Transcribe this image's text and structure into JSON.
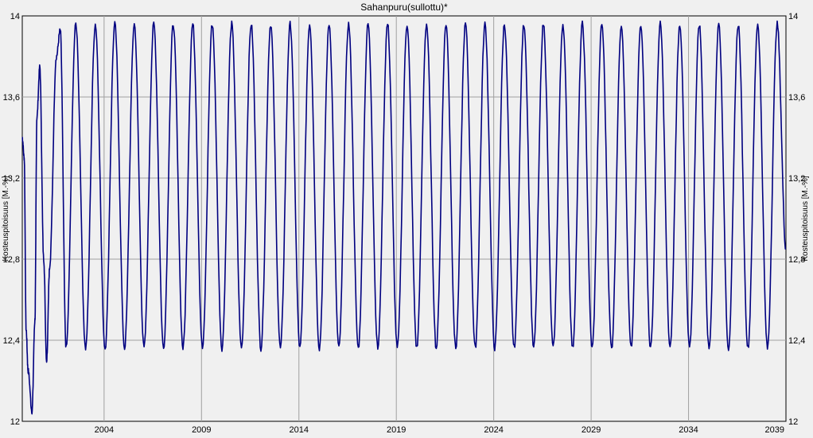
{
  "chart_data": {
    "type": "line",
    "title": "Sahanpuru(sullottu)*",
    "ylabel_left": "Kosteuspitoisuus [M.-%]",
    "ylabel_right": "Kosteuspitoisuus [M.-%]",
    "xlabel": "",
    "xlim": [
      1999.8,
      2039.0
    ],
    "ylim": [
      12,
      14
    ],
    "y_ticks": [
      12,
      12.4,
      12.8,
      13.2,
      13.6,
      14
    ],
    "y_tick_labels": [
      "12",
      "12,4",
      "12,8",
      "13,2",
      "13,6",
      "14"
    ],
    "x_ticks": [
      2004,
      2009,
      2014,
      2019,
      2024,
      2029,
      2034,
      2039
    ],
    "x_tick_labels": [
      "2004",
      "2009",
      "2014",
      "2019",
      "2024",
      "2029",
      "2034",
      "2039"
    ],
    "grid": true,
    "legend": "none",
    "series": [
      {
        "color": "#000080",
        "peak_phase": 0.55,
        "trough_phase": 0.05,
        "x": [
          1999.8,
          1999.9,
          2000.0,
          2000.1,
          2000.3,
          2000.45,
          2000.55,
          2000.7,
          2000.9,
          2001.05,
          2001.2,
          2001.55,
          2001.75,
          2002.05,
          2002.55,
          2003.05,
          2003.55,
          2004.05,
          2004.55,
          2005.05,
          2005.55,
          2006.05,
          2006.55,
          2007.05,
          2007.55,
          2008.05,
          2008.55,
          2009.05,
          2009.55,
          2010.05,
          2010.55,
          2011.05,
          2011.55,
          2012.05,
          2012.55,
          2013.05,
          2013.55,
          2014.05,
          2014.55,
          2015.05,
          2015.55,
          2016.05,
          2016.55,
          2017.05,
          2017.55,
          2018.05,
          2018.55,
          2019.05,
          2019.55,
          2020.05,
          2020.55,
          2021.05,
          2021.55,
          2022.05,
          2022.55,
          2023.05,
          2023.55,
          2024.05,
          2024.55,
          2025.05,
          2025.55,
          2026.05,
          2026.55,
          2027.05,
          2027.55,
          2028.05,
          2028.55,
          2029.05,
          2029.55,
          2030.05,
          2030.55,
          2031.05,
          2031.55,
          2032.05,
          2032.55,
          2033.05,
          2033.55,
          2034.05,
          2034.55,
          2035.05,
          2035.55,
          2036.05,
          2036.55,
          2037.05,
          2037.55,
          2038.05,
          2038.55,
          2039.0
        ],
        "y": [
          13.4,
          13.3,
          12.45,
          12.25,
          12.05,
          12.5,
          13.5,
          13.75,
          12.8,
          12.3,
          12.75,
          13.8,
          13.93,
          12.36,
          13.96,
          12.36,
          13.96,
          12.36,
          13.96,
          12.36,
          13.96,
          12.36,
          13.96,
          12.36,
          13.96,
          12.36,
          13.96,
          12.36,
          13.96,
          12.36,
          13.96,
          12.36,
          13.96,
          12.36,
          13.96,
          12.36,
          13.96,
          12.36,
          13.96,
          12.36,
          13.96,
          12.36,
          13.96,
          12.36,
          13.96,
          12.36,
          13.96,
          12.36,
          13.96,
          12.36,
          13.96,
          12.36,
          13.96,
          12.36,
          13.96,
          12.36,
          13.96,
          12.36,
          13.96,
          12.36,
          13.96,
          12.36,
          13.96,
          12.36,
          13.96,
          12.36,
          13.96,
          12.36,
          13.96,
          12.36,
          13.96,
          12.36,
          13.96,
          12.36,
          13.96,
          12.36,
          13.96,
          12.36,
          13.96,
          12.36,
          13.96,
          12.36,
          13.96,
          12.36,
          13.96,
          12.36,
          13.96,
          12.85
        ]
      }
    ]
  }
}
